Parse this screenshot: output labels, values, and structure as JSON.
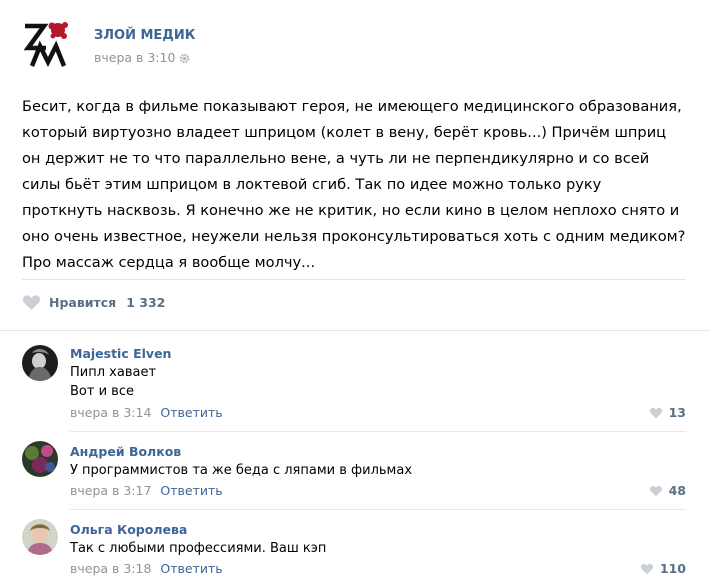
{
  "post": {
    "group_name": "ЗЛОЙ МЕДИК",
    "time": "вчера в 3:10",
    "text": "Бесит, когда в фильме показывают героя, не имеющего медицинского образования, который виртуозно владеет шприцом (колет в вену, берёт кровь...) Причём шприц он держит не то что параллельно вене, а чуть ли не перпендикулярно и со всей силы бьёт этим шприцом в локтевой сгиб. Так по идее можно только руку проткнуть насквозь. Я конечно же не критик, но если кино в целом неплохо снято и оно очень известное, неужели нельзя проконсультироваться хоть с одним медиком? Про массаж сердца я вообще молчу...",
    "like_label": "Нравится",
    "like_count": "1 332"
  },
  "comments": [
    {
      "author": "Majestic Elven",
      "text": "Пипл хавает\nВот и все",
      "time": "вчера в 3:14",
      "reply": "Ответить",
      "likes": "13"
    },
    {
      "author": "Андрей Волков",
      "text": "У программистов та же беда с ляпами в фильмах",
      "time": "вчера в 3:17",
      "reply": "Ответить",
      "likes": "48"
    },
    {
      "author": "Ольга Королева",
      "text": "Так с любыми профессиями. Ваш кэп",
      "time": "вчера в 3:18",
      "reply": "Ответить",
      "likes": "110"
    }
  ],
  "colors": {
    "link": "#3d6596",
    "muted": "#939393",
    "like": "#5b6f86",
    "logo_red": "#b4182b"
  },
  "icons": [
    "group-logo-icon",
    "gear-icon",
    "heart-icon"
  ]
}
